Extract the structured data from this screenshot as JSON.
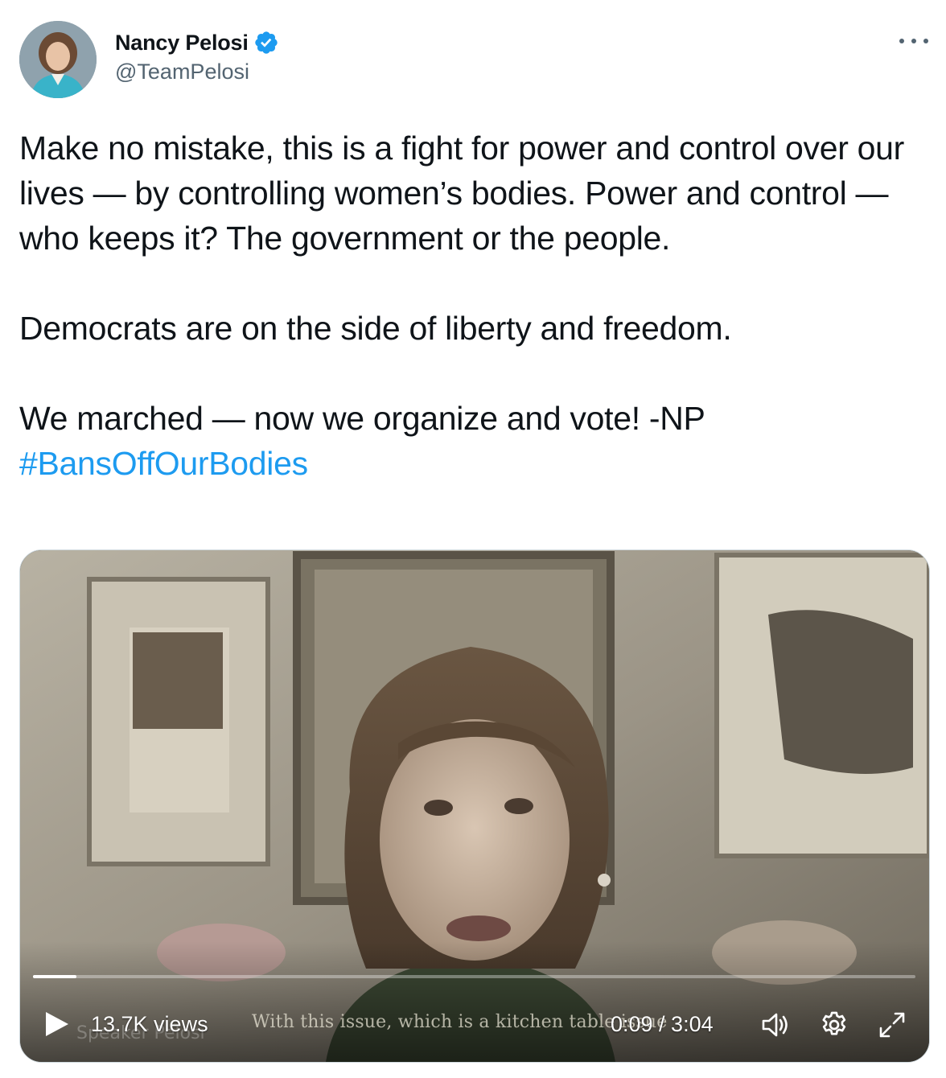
{
  "author": {
    "name": "Nancy Pelosi",
    "handle": "@TeamPelosi",
    "verified": true
  },
  "tweet": {
    "paragraphs": [
      "Make no mistake, this is a fight for power and control over our lives — by controlling women’s bodies. Power and control — who keeps it? The government or the people.",
      "Democrats are on the side of liberty and freedom.",
      "We marched — now we organize and vote! -NP"
    ],
    "hashtag": "#BansOffOurBodies"
  },
  "video": {
    "views": "13.7K views",
    "current_time": "0:09",
    "duration": "3:04",
    "time_text": "0:09 / 3:04",
    "progress_fraction": 0.049,
    "caption": "With this issue, which is a kitchen table issue",
    "watermark": "Speaker Pelosi"
  },
  "icons": {
    "verified": "verified-badge-icon",
    "more": "more-icon",
    "play": "play-icon",
    "volume": "volume-icon",
    "settings": "gear-icon",
    "fullscreen": "fullscreen-icon"
  },
  "colors": {
    "accent": "#1d9bf0",
    "text": "#0f1419",
    "secondary_text": "#536471"
  }
}
